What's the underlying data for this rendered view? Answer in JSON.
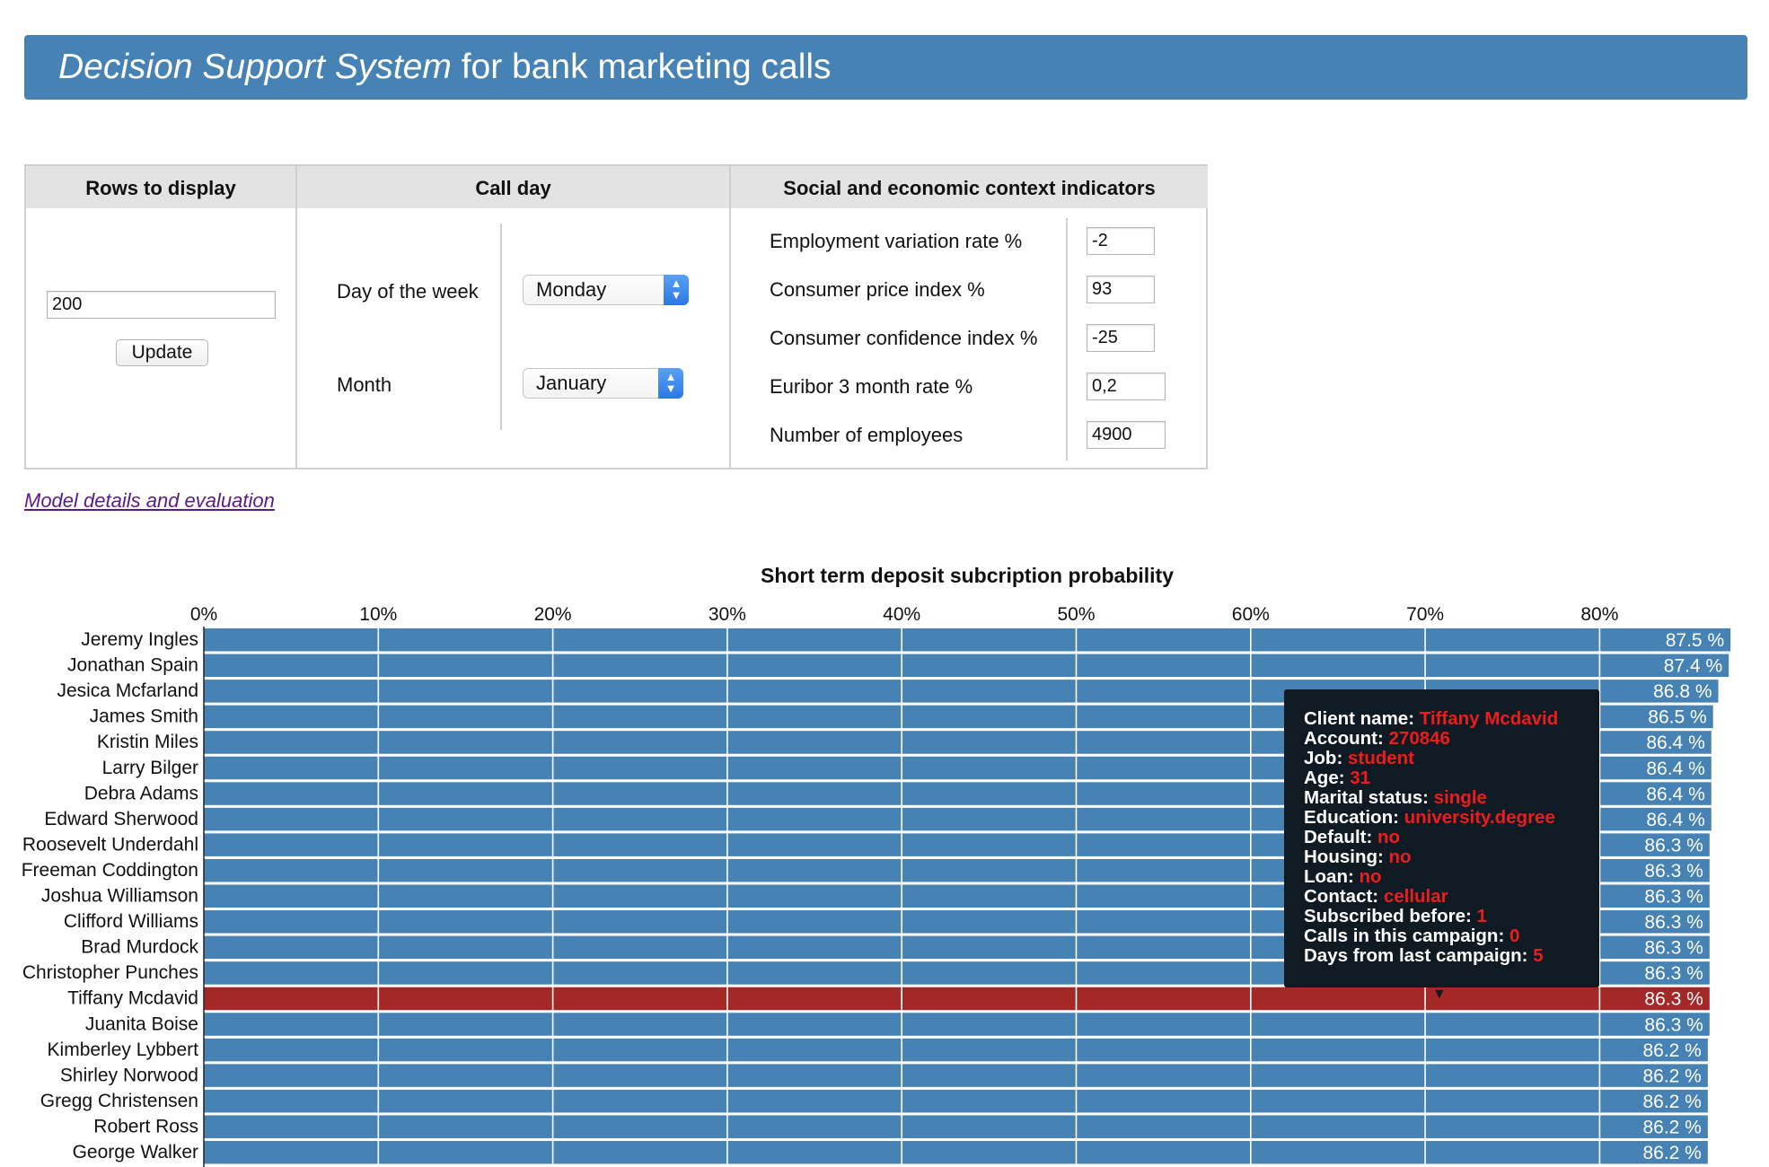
{
  "header": {
    "title_italic": "Decision Support System",
    "title_rest": " for bank marketing calls"
  },
  "controls": {
    "rows": {
      "heading": "Rows to display",
      "value": "200",
      "update_label": "Update"
    },
    "call_day": {
      "heading": "Call day",
      "day_label": "Day of the week",
      "day_value": "Monday",
      "month_label": "Month",
      "month_value": "January"
    },
    "context": {
      "heading": "Social and economic context indicators",
      "items": [
        {
          "label": "Employment variation rate %",
          "value": "-2"
        },
        {
          "label": "Consumer price index %",
          "value": "93"
        },
        {
          "label": "Consumer confidence index %",
          "value": "-25"
        },
        {
          "label": "Euribor 3 month rate %",
          "value": "0,2"
        },
        {
          "label": "Number of employees",
          "value": "4900"
        }
      ]
    }
  },
  "model_link": "Model details and evaluation",
  "chart_data": {
    "type": "bar",
    "orientation": "horizontal",
    "title": "Short term deposit subcription probability",
    "x_ticks": [
      "0%",
      "10%",
      "20%",
      "30%",
      "40%",
      "50%",
      "60%",
      "70%",
      "80%"
    ],
    "xlim": [
      0,
      87.5
    ],
    "bar_color": "#4682b4",
    "highlight_color": "#a52828",
    "highlight_index": 14,
    "categories": [
      "Jeremy Ingles",
      "Jonathan Spain",
      "Jesica Mcfarland",
      "James Smith",
      "Kristin Miles",
      "Larry Bilger",
      "Debra Adams",
      "Edward Sherwood",
      "Roosevelt Underdahl",
      "Freeman Coddington",
      "Joshua Williamson",
      "Clifford Williams",
      "Brad Murdock",
      "Christopher Punches",
      "Tiffany Mcdavid",
      "Juanita Boise",
      "Kimberley Lybbert",
      "Shirley Norwood",
      "Gregg Christensen",
      "Robert Ross",
      "George Walker"
    ],
    "values": [
      87.5,
      87.4,
      86.8,
      86.5,
      86.4,
      86.4,
      86.4,
      86.4,
      86.3,
      86.3,
      86.3,
      86.3,
      86.3,
      86.3,
      86.3,
      86.3,
      86.2,
      86.2,
      86.2,
      86.2,
      86.2
    ],
    "value_labels": [
      "87.5 %",
      "87.4 %",
      "86.8 %",
      "86.5 %",
      "86.4 %",
      "86.4 %",
      "86.4 %",
      "86.4 %",
      "86.3 %",
      "86.3 %",
      "86.3 %",
      "86.3 %",
      "86.3 %",
      "86.3 %",
      "86.3 %",
      "86.3 %",
      "86.2 %",
      "86.2 %",
      "86.2 %",
      "86.2 %",
      "86.2 %"
    ]
  },
  "tooltip": {
    "rows": [
      {
        "label": "Client name: ",
        "value": "Tiffany Mcdavid"
      },
      {
        "label": "Account: ",
        "value": "270846"
      },
      {
        "label": "Job: ",
        "value": "student"
      },
      {
        "label": "Age: ",
        "value": "31"
      },
      {
        "label": "Marital status: ",
        "value": "single"
      },
      {
        "label": "Education: ",
        "value": "university.degree"
      },
      {
        "label": "Default: ",
        "value": "no"
      },
      {
        "label": "Housing: ",
        "value": "no"
      },
      {
        "label": "Loan: ",
        "value": "no"
      },
      {
        "label": "Contact: ",
        "value": "cellular"
      },
      {
        "label": "Subscribed before: ",
        "value": "1"
      },
      {
        "label": "Calls in this campaign: ",
        "value": "0"
      },
      {
        "label": "Days from last campaign: ",
        "value": "5"
      }
    ]
  }
}
